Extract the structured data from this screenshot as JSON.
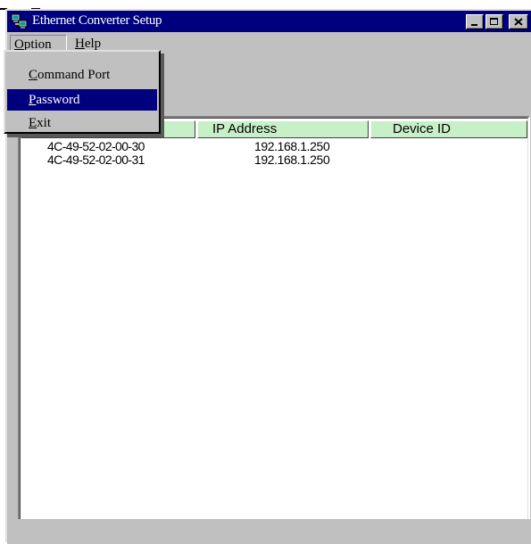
{
  "window": {
    "title": "Ethernet Converter Setup",
    "colors": {
      "titlebar": "#00007f",
      "face": "#c0c0c0",
      "header": "#c8f0c8",
      "highlight": "#00007f"
    }
  },
  "titlebar_buttons": [
    {
      "name": "minimize",
      "icon": "minimize-icon"
    },
    {
      "name": "maximize",
      "icon": "maximize-icon"
    },
    {
      "name": "close",
      "icon": "close-icon"
    }
  ],
  "menubar": {
    "option": {
      "label_first": "O",
      "label_rest": "ption"
    },
    "help": {
      "label_first": "H",
      "label_rest": "elp"
    }
  },
  "dropdown": {
    "items": [
      {
        "label_first": "C",
        "label_rest": "ommand Port",
        "highlighted": false
      },
      {
        "label_first": "P",
        "label_rest": "assword",
        "highlighted": true
      },
      {
        "label_first": "E",
        "label_rest": "xit",
        "highlighted": false
      }
    ]
  },
  "table": {
    "columns": [
      "",
      "IP   Address",
      "Device   ID"
    ],
    "rows": [
      {
        "mac": "4C-49-52-02-00-30",
        "ip": "192.168.1.250",
        "device_id": ""
      },
      {
        "mac": "4C-49-52-02-00-31",
        "ip": "192.168.1.250",
        "device_id": ""
      }
    ]
  }
}
